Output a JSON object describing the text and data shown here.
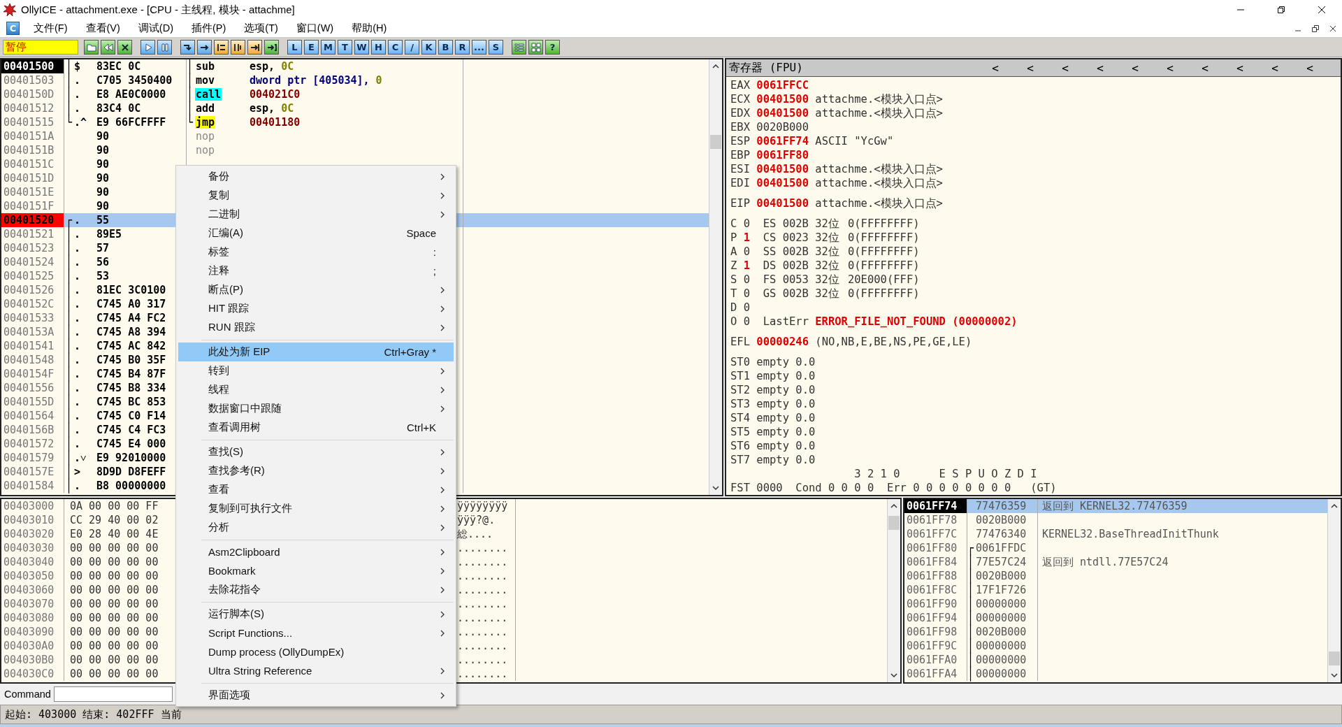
{
  "window": {
    "title": "OllyICE - attachment.exe - [CPU -  主线程, 模块 - attachme]"
  },
  "menu_bar": {
    "icon_label": "C",
    "items": [
      "文件(F)",
      "查看(V)",
      "调试(D)",
      "插件(P)",
      "选项(T)",
      "窗口(W)",
      "帮助(H)"
    ]
  },
  "toolbar": {
    "status": "暂停",
    "letter_buttons": [
      "L",
      "E",
      "M",
      "T",
      "W",
      "H",
      "C",
      "/",
      "K",
      "B",
      "R",
      "...",
      "S"
    ],
    "help_button": "?"
  },
  "disassembly": {
    "rows": [
      {
        "address": "00401500",
        "current": true,
        "breakpoint": false,
        "flow": "│",
        "mark": "$",
        "hex": "83EC 0C",
        "code_flow": "│",
        "mnemonic": "sub",
        "kind": "plain",
        "operands": [
          {
            "text": "esp,",
            "kind": "reg"
          },
          {
            "text": "0C",
            "kind": "const"
          }
        ],
        "selected": false
      },
      {
        "address": "00401503",
        "current": false,
        "breakpoint": false,
        "flow": "│",
        "mark": ".",
        "hex": "C705 3450400",
        "code_flow": "│",
        "mnemonic": "mov",
        "kind": "plain",
        "operands": [
          {
            "text": "dword ptr [405034],",
            "kind": "mem"
          },
          {
            "text": "0",
            "kind": "const"
          }
        ],
        "selected": false
      },
      {
        "address": "0040150D",
        "current": false,
        "breakpoint": false,
        "flow": "│",
        "mark": ".",
        "hex": "E8 AE0C0000",
        "code_flow": "│",
        "mnemonic": "call",
        "kind": "call",
        "operands": [
          {
            "text": "004021C0",
            "kind": "addr"
          }
        ],
        "selected": false
      },
      {
        "address": "00401512",
        "current": false,
        "breakpoint": false,
        "flow": "│",
        "mark": ".",
        "hex": "83C4 0C",
        "code_flow": "│",
        "mnemonic": "add",
        "kind": "plain",
        "operands": [
          {
            "text": "esp,",
            "kind": "reg"
          },
          {
            "text": "0C",
            "kind": "const"
          }
        ],
        "selected": false
      },
      {
        "address": "00401515",
        "current": false,
        "breakpoint": false,
        "flow": "└",
        "mark": ".^",
        "hex": "E9 66FCFFFF",
        "code_flow": "└",
        "mnemonic": "jmp",
        "kind": "jmp",
        "operands": [
          {
            "text": "00401180",
            "kind": "addr"
          }
        ],
        "selected": false
      },
      {
        "address": "0040151A",
        "current": false,
        "breakpoint": false,
        "hex": "90",
        "mnemonic": "nop",
        "kind": "nop",
        "selected": false
      },
      {
        "address": "0040151B",
        "current": false,
        "breakpoint": false,
        "hex": "90",
        "mnemonic": "nop",
        "kind": "nop",
        "selected": false
      },
      {
        "address": "0040151C",
        "current": false,
        "breakpoint": false,
        "hex": "90",
        "selected": false
      },
      {
        "address": "0040151D",
        "current": false,
        "breakpoint": false,
        "hex": "90",
        "selected": false
      },
      {
        "address": "0040151E",
        "current": false,
        "breakpoint": false,
        "hex": "90",
        "selected": false
      },
      {
        "address": "0040151F",
        "current": false,
        "breakpoint": false,
        "hex": "90",
        "selected": false
      },
      {
        "address": "00401520",
        "current": false,
        "breakpoint": true,
        "flow": "┌",
        "mark": ".",
        "hex": "55",
        "selected": true
      },
      {
        "address": "00401521",
        "current": false,
        "breakpoint": false,
        "flow": "│",
        "mark": ".",
        "hex": "89E5",
        "selected": false
      },
      {
        "address": "00401523",
        "current": false,
        "breakpoint": false,
        "flow": "│",
        "mark": ".",
        "hex": "57",
        "selected": false
      },
      {
        "address": "00401524",
        "current": false,
        "breakpoint": false,
        "flow": "│",
        "mark": ".",
        "hex": "56",
        "selected": false
      },
      {
        "address": "00401525",
        "current": false,
        "breakpoint": false,
        "flow": "│",
        "mark": ".",
        "hex": "53",
        "selected": false
      },
      {
        "address": "00401526",
        "current": false,
        "breakpoint": false,
        "flow": "│",
        "mark": ".",
        "hex": "81EC 3C0100",
        "selected": false
      },
      {
        "address": "0040152C",
        "current": false,
        "breakpoint": false,
        "flow": "│",
        "mark": ".",
        "hex": "C745 A0 317",
        "selected": false
      },
      {
        "address": "00401533",
        "current": false,
        "breakpoint": false,
        "flow": "│",
        "mark": ".",
        "hex": "C745 A4 FC2",
        "selected": false
      },
      {
        "address": "0040153A",
        "current": false,
        "breakpoint": false,
        "flow": "│",
        "mark": ".",
        "hex": "C745 A8 394",
        "selected": false
      },
      {
        "address": "00401541",
        "current": false,
        "breakpoint": false,
        "flow": "│",
        "mark": ".",
        "hex": "C745 AC 842",
        "selected": false
      },
      {
        "address": "00401548",
        "current": false,
        "breakpoint": false,
        "flow": "│",
        "mark": ".",
        "hex": "C745 B0 35F",
        "selected": false
      },
      {
        "address": "0040154F",
        "current": false,
        "breakpoint": false,
        "flow": "│",
        "mark": ".",
        "hex": "C745 B4 87F",
        "selected": false
      },
      {
        "address": "00401556",
        "current": false,
        "breakpoint": false,
        "flow": "│",
        "mark": ".",
        "hex": "C745 B8 334",
        "selected": false
      },
      {
        "address": "0040155D",
        "current": false,
        "breakpoint": false,
        "flow": "│",
        "mark": ".",
        "hex": "C745 BC 853",
        "selected": false
      },
      {
        "address": "00401564",
        "current": false,
        "breakpoint": false,
        "flow": "│",
        "mark": ".",
        "hex": "C745 C0 F14",
        "selected": false
      },
      {
        "address": "0040156B",
        "current": false,
        "breakpoint": false,
        "flow": "│",
        "mark": ".",
        "hex": "C745 C4 FC3",
        "selected": false
      },
      {
        "address": "00401572",
        "current": false,
        "breakpoint": false,
        "flow": "│",
        "mark": ".",
        "hex": "C745 E4 000",
        "selected": false
      },
      {
        "address": "00401579",
        "current": false,
        "breakpoint": false,
        "flow": "│",
        "mark": ".˅",
        "hex": "E9 92010000",
        "selected": false
      },
      {
        "address": "0040157E",
        "current": false,
        "breakpoint": false,
        "flow": "│",
        "mark": ">",
        "hex": "8D9D D8FEFF",
        "selected": false
      },
      {
        "address": "00401584",
        "current": false,
        "breakpoint": false,
        "flow": "│",
        "mark": ".",
        "hex": "B8 00000000",
        "selected": false
      }
    ]
  },
  "registers": {
    "title": "寄存器 (FPU)",
    "chevrons": [
      "<",
      "<",
      "<",
      "<",
      "<",
      "<",
      "<",
      "<",
      "<",
      "<"
    ],
    "general": [
      {
        "name": "EAX",
        "value": "0061FFCC",
        "changed": true
      },
      {
        "name": "ECX",
        "value": "00401500",
        "changed": true,
        "comment": "attachme.<模块入口点>"
      },
      {
        "name": "EDX",
        "value": "00401500",
        "changed": true,
        "comment": "attachme.<模块入口点>"
      },
      {
        "name": "EBX",
        "value": "0020B000",
        "changed": false
      },
      {
        "name": "ESP",
        "value": "0061FF74",
        "changed": true,
        "comment": "ASCII \"YcGw\""
      },
      {
        "name": "EBP",
        "value": "0061FF80",
        "changed": true
      },
      {
        "name": "ESI",
        "value": "00401500",
        "changed": true,
        "comment": "attachme.<模块入口点>"
      },
      {
        "name": "EDI",
        "value": "00401500",
        "changed": true,
        "comment": "attachme.<模块入口点>"
      }
    ],
    "eip": {
      "name": "EIP",
      "value": "00401500",
      "changed": true,
      "comment": "attachme.<模块入口点>"
    },
    "flags": [
      {
        "flag": "C",
        "value": "0",
        "changed": false,
        "segment": {
          "name": "ES",
          "selector": "002B",
          "bits": "32位",
          "base": "0(FFFFFFFF)"
        }
      },
      {
        "flag": "P",
        "value": "1",
        "changed": true,
        "segment": {
          "name": "CS",
          "selector": "0023",
          "bits": "32位",
          "base": "0(FFFFFFFF)"
        }
      },
      {
        "flag": "A",
        "value": "0",
        "changed": false,
        "segment": {
          "name": "SS",
          "selector": "002B",
          "bits": "32位",
          "base": "0(FFFFFFFF)"
        }
      },
      {
        "flag": "Z",
        "value": "1",
        "changed": true,
        "segment": {
          "name": "DS",
          "selector": "002B",
          "bits": "32位",
          "base": "0(FFFFFFFF)"
        }
      },
      {
        "flag": "S",
        "value": "0",
        "changed": false,
        "segment": {
          "name": "FS",
          "selector": "0053",
          "bits": "32位",
          "base": "20E000(FFF)"
        }
      },
      {
        "flag": "T",
        "value": "0",
        "changed": false,
        "segment": {
          "name": "GS",
          "selector": "002B",
          "bits": "32位",
          "base": "0(FFFFFFFF)"
        }
      },
      {
        "flag": "D",
        "value": "0",
        "changed": false
      },
      {
        "flag": "O",
        "value": "0",
        "changed": false,
        "last_error": {
          "label": "LastErr",
          "value": "ERROR_FILE_NOT_FOUND (00000002)"
        }
      }
    ],
    "efl": {
      "name": "EFL",
      "value": "00000246",
      "changed": true,
      "description": "(NO,NB,E,BE,NS,PE,GE,LE)"
    },
    "fpu": [
      {
        "name": "ST0",
        "tag": "empty",
        "value": "0.0"
      },
      {
        "name": "ST1",
        "tag": "empty",
        "value": "0.0"
      },
      {
        "name": "ST2",
        "tag": "empty",
        "value": "0.0"
      },
      {
        "name": "ST3",
        "tag": "empty",
        "value": "0.0"
      },
      {
        "name": "ST4",
        "tag": "empty",
        "value": "0.0"
      },
      {
        "name": "ST5",
        "tag": "empty",
        "value": "0.0"
      },
      {
        "name": "ST6",
        "tag": "empty",
        "value": "0.0"
      },
      {
        "name": "ST7",
        "tag": "empty",
        "value": "0.0"
      }
    ],
    "fst": {
      "cond_header": "3 2 1 0",
      "err_header": "E S P U O Z D I",
      "label": "FST",
      "value": "0000",
      "cond_label": "Cond",
      "cond": "0 0 0 0",
      "err_label": "Err",
      "err": "0 0 0 0 0 0 0 0",
      "flag": "(GT)"
    }
  },
  "dump": {
    "rows": [
      {
        "address": "00403000",
        "hex": "0A 00 00 00 FF",
        "ascii": "ÿÿÿÿÿÿÿÿ"
      },
      {
        "address": "00403010",
        "hex": "CC 29 40 00 02",
        "ascii": "ÿÿÿ?@."
      },
      {
        "address": "00403020",
        "hex": "E0 28 40 00 4E",
        "ascii": "総...."
      },
      {
        "address": "00403030",
        "hex": "00 00 00 00 00",
        "ascii": "........"
      },
      {
        "address": "00403040",
        "hex": "00 00 00 00 00",
        "ascii": "........"
      },
      {
        "address": "00403050",
        "hex": "00 00 00 00 00",
        "ascii": "........"
      },
      {
        "address": "00403060",
        "hex": "00 00 00 00 00",
        "ascii": "........"
      },
      {
        "address": "00403070",
        "hex": "00 00 00 00 00",
        "ascii": "........"
      },
      {
        "address": "00403080",
        "hex": "00 00 00 00 00",
        "ascii": "........"
      },
      {
        "address": "00403090",
        "hex": "00 00 00 00 00",
        "ascii": "........"
      },
      {
        "address": "004030A0",
        "hex": "00 00 00 00 00",
        "ascii": "........"
      },
      {
        "address": "004030B0",
        "hex": "00 00 00 00 00",
        "ascii": "........"
      },
      {
        "address": "004030C0",
        "hex": "00 00 00 00 00",
        "ascii": "........"
      }
    ]
  },
  "stack": {
    "rows": [
      {
        "address": "0061FF74",
        "current": true,
        "value": "77476359",
        "comment": "返回到 KERNEL32.77476359",
        "selected": true
      },
      {
        "address": "0061FF78",
        "current": false,
        "value": "0020B000",
        "selected": false
      },
      {
        "address": "0061FF7C",
        "current": false,
        "value": "77476340",
        "comment": "KERNEL32.BaseThreadInitThunk",
        "selected": false
      },
      {
        "address": "0061FF80",
        "current": false,
        "flow": "┌",
        "value": "0061FFDC",
        "selected": false
      },
      {
        "address": "0061FF84",
        "current": false,
        "flow": "│",
        "value": "77E57C24",
        "comment": "返回到 ntdll.77E57C24",
        "selected": false
      },
      {
        "address": "0061FF88",
        "current": false,
        "flow": "│",
        "value": "0020B000",
        "selected": false
      },
      {
        "address": "0061FF8C",
        "current": false,
        "flow": "│",
        "value": "17F1F726",
        "selected": false
      },
      {
        "address": "0061FF90",
        "current": false,
        "flow": "│",
        "value": "00000000",
        "selected": false
      },
      {
        "address": "0061FF94",
        "current": false,
        "flow": "│",
        "value": "00000000",
        "selected": false
      },
      {
        "address": "0061FF98",
        "current": false,
        "flow": "│",
        "value": "0020B000",
        "selected": false
      },
      {
        "address": "0061FF9C",
        "current": false,
        "flow": "│",
        "value": "00000000",
        "selected": false
      },
      {
        "address": "0061FFA0",
        "current": false,
        "flow": "│",
        "value": "00000000",
        "selected": false
      },
      {
        "address": "0061FFA4",
        "current": false,
        "flow": "│",
        "value": "00000000",
        "selected": false
      }
    ]
  },
  "command_bar": {
    "label": "Command"
  },
  "status_bar": {
    "text": "起始: 403000 结束: 402FFF 当前"
  },
  "context_menu": {
    "groups": [
      [
        {
          "label": "备份",
          "submenu": true,
          "selected": false
        },
        {
          "label": "复制",
          "submenu": true,
          "selected": false
        },
        {
          "label": "二进制",
          "submenu": true,
          "selected": false
        },
        {
          "label": "汇编(A)",
          "shortcut": "Space",
          "submenu": false,
          "selected": false
        },
        {
          "label": "标签",
          "shortcut": ":",
          "submenu": false,
          "selected": false
        },
        {
          "label": "注释",
          "shortcut": ";",
          "submenu": false,
          "selected": false
        },
        {
          "label": "断点(P)",
          "submenu": true,
          "selected": false
        },
        {
          "label": "HIT 跟踪",
          "submenu": true,
          "selected": false
        },
        {
          "label": "RUN 跟踪",
          "submenu": true,
          "selected": false
        }
      ],
      [
        {
          "label": "此处为新 EIP",
          "shortcut": "Ctrl+Gray *",
          "submenu": false,
          "selected": true
        },
        {
          "label": "转到",
          "submenu": true,
          "selected": false
        },
        {
          "label": "线程",
          "submenu": true,
          "selected": false
        },
        {
          "label": "数据窗口中跟随",
          "submenu": true,
          "selected": false
        },
        {
          "label": "查看调用树",
          "shortcut": "Ctrl+K",
          "submenu": false,
          "selected": false
        }
      ],
      [
        {
          "label": "查找(S)",
          "submenu": true,
          "selected": false
        },
        {
          "label": "查找参考(R)",
          "submenu": true,
          "selected": false
        },
        {
          "label": "查看",
          "submenu": true,
          "selected": false
        },
        {
          "label": "复制到可执行文件",
          "submenu": true,
          "selected": false
        },
        {
          "label": "分析",
          "submenu": true,
          "selected": false
        }
      ],
      [
        {
          "label": "Asm2Clipboard",
          "submenu": true,
          "selected": false
        },
        {
          "label": "Bookmark",
          "submenu": true,
          "selected": false
        },
        {
          "label": "去除花指令",
          "submenu": true,
          "selected": false
        }
      ],
      [
        {
          "label": "运行脚本(S)",
          "submenu": true,
          "selected": false
        },
        {
          "label": "Script Functions...",
          "submenu": true,
          "selected": false
        },
        {
          "label": "Dump process (OllyDumpEx)",
          "submenu": false,
          "selected": false
        },
        {
          "label": "Ultra String Reference",
          "submenu": true,
          "selected": false
        }
      ],
      [
        {
          "label": "界面选项",
          "submenu": true,
          "selected": false
        }
      ]
    ]
  }
}
